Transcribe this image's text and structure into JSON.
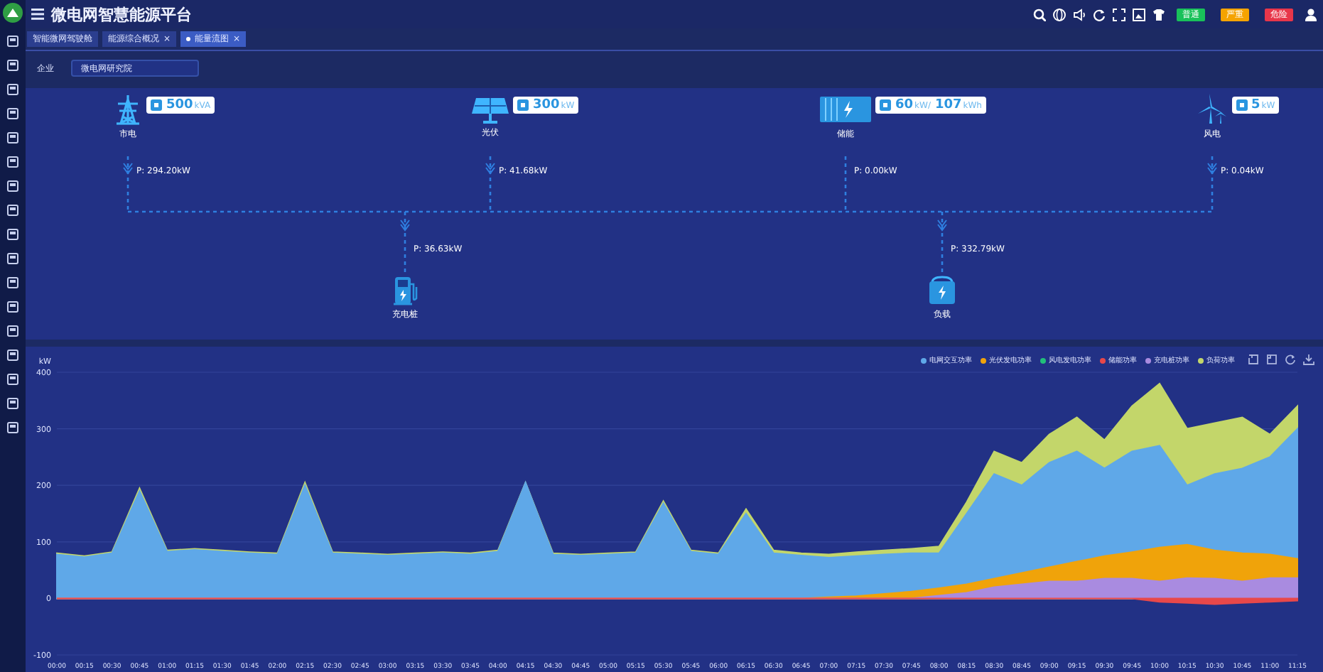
{
  "header": {
    "title": "微电网智慧能源平台",
    "alarms": [
      {
        "label": "普通",
        "color": "#19c15a"
      },
      {
        "label": "严重",
        "color": "#f5a300"
      },
      {
        "label": "危险",
        "color": "#e8364a"
      }
    ]
  },
  "tabs": [
    {
      "label": "智能微网驾驶舱",
      "selected": false
    },
    {
      "label": "能源综合概况",
      "close": "×",
      "selected": false
    },
    {
      "label": "能量流图",
      "close": "×",
      "selected": true
    }
  ],
  "filter": {
    "label": "企业",
    "value": "微电网研究院"
  },
  "diagram": {
    "sources": [
      {
        "kind": "tower",
        "label": "市电",
        "rating": [
          {
            "value": "500",
            "unit": "kVA"
          }
        ],
        "power": "P: 294.20kW"
      },
      {
        "kind": "solar",
        "label": "光伏",
        "rating": [
          {
            "value": "300",
            "unit": "kW"
          }
        ],
        "power": "P: 41.68kW"
      },
      {
        "kind": "battery",
        "label": "储能",
        "rating": [
          {
            "value": "60",
            "unit": "kW/"
          },
          {
            "value": "107",
            "unit": "kWh"
          }
        ],
        "power": "P: 0.00kW"
      },
      {
        "kind": "wind",
        "label": "风电",
        "rating": [
          {
            "value": "5",
            "unit": "kW"
          }
        ],
        "power": "P: 0.04kW"
      }
    ],
    "loads": [
      {
        "kind": "charger",
        "label": "充电桩",
        "power": "P: 36.63kW"
      },
      {
        "kind": "load",
        "label": "负载",
        "power": "P: 332.79kW"
      }
    ]
  },
  "chart": {
    "chart_data": {
      "type": "area",
      "grid": true,
      "ylabel": "kW",
      "ylim": [
        -100,
        400
      ],
      "yticks": [
        -100,
        0,
        100,
        200,
        300,
        400
      ],
      "categories": [
        "00:00",
        "00:15",
        "00:30",
        "00:45",
        "01:00",
        "01:15",
        "01:30",
        "01:45",
        "02:00",
        "02:15",
        "02:30",
        "02:45",
        "03:00",
        "03:15",
        "03:30",
        "03:45",
        "04:00",
        "04:15",
        "04:30",
        "04:45",
        "05:00",
        "05:15",
        "05:30",
        "05:45",
        "06:00",
        "06:15",
        "06:30",
        "06:45",
        "07:00",
        "07:15",
        "07:30",
        "07:45",
        "08:00",
        "08:15",
        "08:30",
        "08:45",
        "09:00",
        "09:15",
        "09:30",
        "09:45",
        "10:00",
        "10:15",
        "10:30",
        "10:45",
        "11:00",
        "11:15"
      ],
      "series": [
        {
          "name": "电网交互功率",
          "color": "#5fa8e8",
          "values": [
            78,
            73,
            80,
            190,
            83,
            86,
            83,
            80,
            78,
            200,
            80,
            78,
            76,
            78,
            80,
            78,
            83,
            205,
            78,
            76,
            78,
            80,
            168,
            83,
            78,
            150,
            80,
            76,
            72,
            75,
            78,
            80,
            80,
            150,
            220,
            200,
            240,
            260,
            230,
            260,
            270,
            200,
            220,
            230,
            250,
            300
          ]
        },
        {
          "name": "光伏发电功率",
          "color": "#f0a30a",
          "values": [
            0,
            0,
            0,
            0,
            0,
            0,
            0,
            0,
            0,
            0,
            0,
            0,
            0,
            0,
            0,
            0,
            0,
            0,
            0,
            0,
            0,
            0,
            0,
            0,
            0,
            0,
            0,
            0,
            2,
            4,
            8,
            12,
            18,
            25,
            35,
            45,
            55,
            65,
            75,
            82,
            90,
            95,
            85,
            80,
            78,
            70
          ]
        },
        {
          "name": "风电发电功率",
          "color": "#22c07a",
          "values": [
            null,
            null,
            null,
            null,
            null,
            null,
            null,
            null,
            null,
            null,
            null,
            null,
            null,
            null,
            null,
            null,
            null,
            null,
            null,
            null,
            null,
            null,
            null,
            null,
            null,
            null,
            null,
            null,
            null,
            null,
            null,
            null,
            null,
            null,
            null,
            null,
            null,
            null,
            null,
            null,
            null,
            null,
            null,
            null,
            null,
            null
          ]
        },
        {
          "name": "储能功率",
          "color": "#e8484a",
          "values": [
            0,
            0,
            0,
            0,
            0,
            0,
            0,
            0,
            0,
            0,
            0,
            0,
            0,
            0,
            0,
            0,
            0,
            0,
            0,
            0,
            0,
            0,
            0,
            0,
            0,
            0,
            0,
            0,
            0,
            0,
            0,
            0,
            0,
            0,
            0,
            0,
            0,
            0,
            0,
            0,
            -6,
            -8,
            -10,
            -8,
            -6,
            -4
          ]
        },
        {
          "name": "充电桩功率",
          "color": "#a98be0",
          "values": [
            0,
            0,
            0,
            0,
            0,
            0,
            0,
            0,
            0,
            0,
            0,
            0,
            0,
            0,
            0,
            0,
            0,
            0,
            0,
            0,
            0,
            0,
            0,
            0,
            0,
            0,
            0,
            0,
            0,
            0,
            0,
            0,
            5,
            10,
            20,
            25,
            30,
            30,
            35,
            35,
            30,
            36,
            35,
            30,
            36,
            36
          ]
        },
        {
          "name": "负荷功率",
          "color": "#c3d66a",
          "values": [
            80,
            75,
            82,
            195,
            85,
            88,
            85,
            82,
            80,
            205,
            82,
            80,
            78,
            80,
            82,
            80,
            85,
            205,
            80,
            78,
            80,
            82,
            172,
            85,
            80,
            158,
            85,
            80,
            78,
            82,
            85,
            88,
            92,
            170,
            260,
            240,
            290,
            320,
            280,
            340,
            380,
            300,
            310,
            320,
            290,
            340
          ]
        }
      ]
    }
  }
}
